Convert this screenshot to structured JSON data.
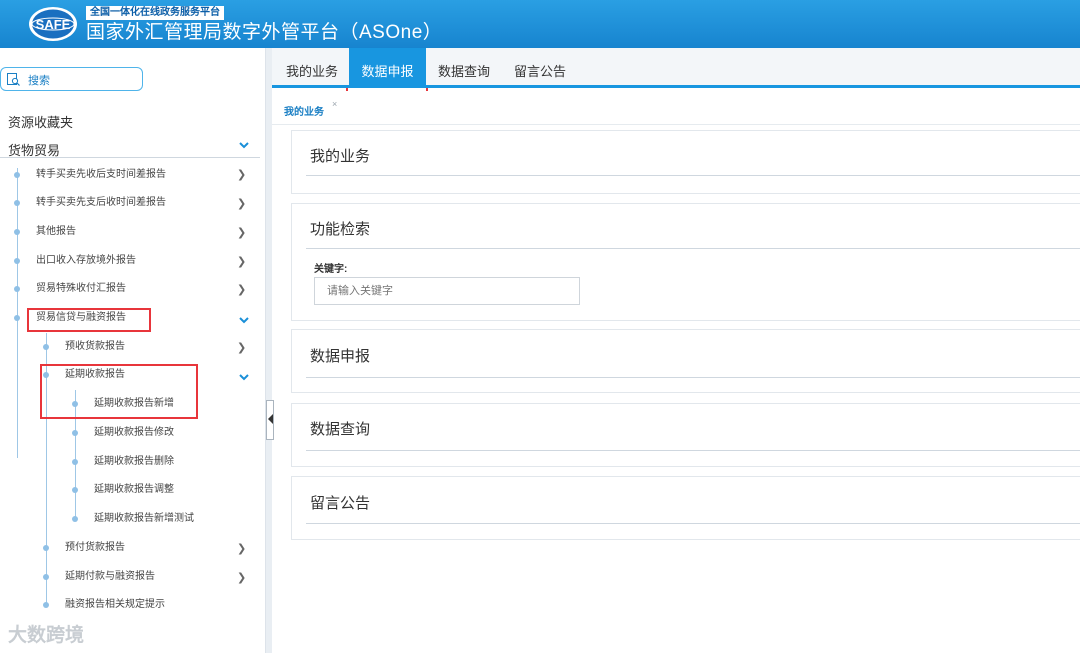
{
  "header": {
    "logo_text": "SAFE",
    "subtitle": "全国一体化在线政务服务平台",
    "title": "国家外汇管理局数字外管平台（ASOne）"
  },
  "sidebar": {
    "search_label": "搜索",
    "favorites": "资源收藏夹",
    "group": "货物贸易",
    "items": [
      {
        "label": "转手买卖先收后支时间差报告"
      },
      {
        "label": "转手买卖先支后收时间差报告"
      },
      {
        "label": "其他报告"
      },
      {
        "label": "出口收入存放境外报告"
      },
      {
        "label": "贸易特殊收付汇报告"
      },
      {
        "label": "贸易信贷与融资报告"
      },
      {
        "label": "预收货款报告"
      },
      {
        "label": "延期收款报告"
      },
      {
        "label": "延期收款报告新增"
      },
      {
        "label": "延期收款报告修改"
      },
      {
        "label": "延期收款报告删除"
      },
      {
        "label": "延期收款报告调整"
      },
      {
        "label": "延期收款报告新增测试"
      },
      {
        "label": "预付货款报告"
      },
      {
        "label": "延期付款与融资报告"
      },
      {
        "label": "融资报告相关规定提示"
      }
    ]
  },
  "tabs": [
    {
      "label": "我的业务"
    },
    {
      "label": "数据申报"
    },
    {
      "label": "数据查询"
    },
    {
      "label": "留言公告"
    }
  ],
  "active_tab": "数据申报",
  "breadcrumb": {
    "label": "我的业务",
    "close": "×"
  },
  "panels": {
    "my_business": "我的业务",
    "function_search": "功能检索",
    "keyword_label": "关键字:",
    "keyword_placeholder": "请输入关键字",
    "data_report": "数据申报",
    "data_query": "数据查询",
    "announcements": "留言公告"
  },
  "watermark": "大数跨境",
  "colors": {
    "header_blue": "#1784cf",
    "accent_blue": "#1896e0",
    "highlight_red": "#e8353b"
  }
}
